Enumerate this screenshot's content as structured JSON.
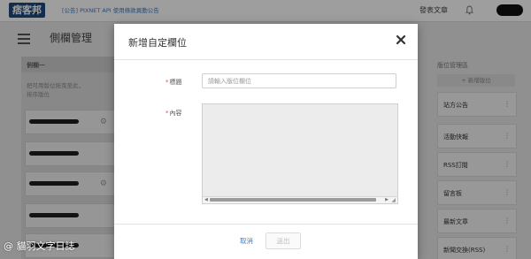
{
  "header": {
    "logo": "痞客邦",
    "announcement": "[公告] PIXNET API 使用條款異動公告",
    "post_article": "發表文章"
  },
  "page": {
    "title": "側欄管理"
  },
  "left_panel": {
    "title": "側欄一",
    "hint_line1": "把可用版位拖曳至此，",
    "hint_line2": "排序版位"
  },
  "right_panel": {
    "title": "版位管理區",
    "add_button": "+ 新增版位",
    "items": [
      {
        "label": "站方公告"
      },
      {
        "label": "活動快報"
      },
      {
        "label": "RSS訂閱"
      },
      {
        "label": "留言板"
      },
      {
        "label": "最新文章"
      },
      {
        "label": "新聞交換(RSS)"
      }
    ]
  },
  "modal": {
    "title": "新增自定欄位",
    "title_label": "標題",
    "title_placeholder": "請輸入版位欄位",
    "title_value": "",
    "content_label": "內容",
    "required_mark": "*",
    "cancel": "取消",
    "submit": "送出"
  },
  "watermark": "@ 貓羽文字日誌"
}
